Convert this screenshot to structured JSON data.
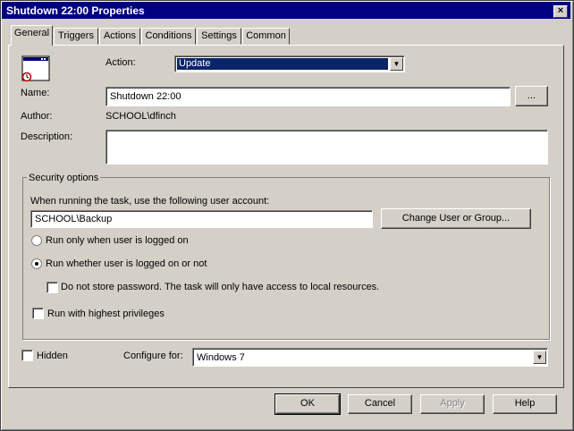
{
  "window": {
    "title": "Shutdown 22:00 Properties",
    "close_glyph": "×"
  },
  "tabs": [
    "General",
    "Triggers",
    "Actions",
    "Conditions",
    "Settings",
    "Common"
  ],
  "general": {
    "action_label": "Action:",
    "action_value": "Update",
    "name_label": "Name:",
    "name_value": "Shutdown 22:00",
    "browse_label": "...",
    "author_label": "Author:",
    "author_value": "SCHOOL\\dfinch",
    "description_label": "Description:",
    "description_value": ""
  },
  "security": {
    "title": "Security options",
    "account_prompt": "When running the task, use the following user account:",
    "account_value": "SCHOOL\\Backup",
    "change_button": "Change User or Group...",
    "radio_logged_on": "Run only when user is logged on",
    "radio_whether": "Run whether user is logged on or not",
    "no_store_password": "Do not store password. The task will only have access to local resources.",
    "highest_privileges": "Run with highest privileges"
  },
  "hidden_label": "Hidden",
  "configure_label": "Configure for:",
  "configure_value": "Windows 7",
  "buttons": {
    "ok": "OK",
    "cancel": "Cancel",
    "apply": "Apply",
    "help": "Help"
  },
  "colors": {
    "title_bar": "#000080",
    "selected_bg": "#0a246a",
    "face": "#d4d0c8"
  }
}
